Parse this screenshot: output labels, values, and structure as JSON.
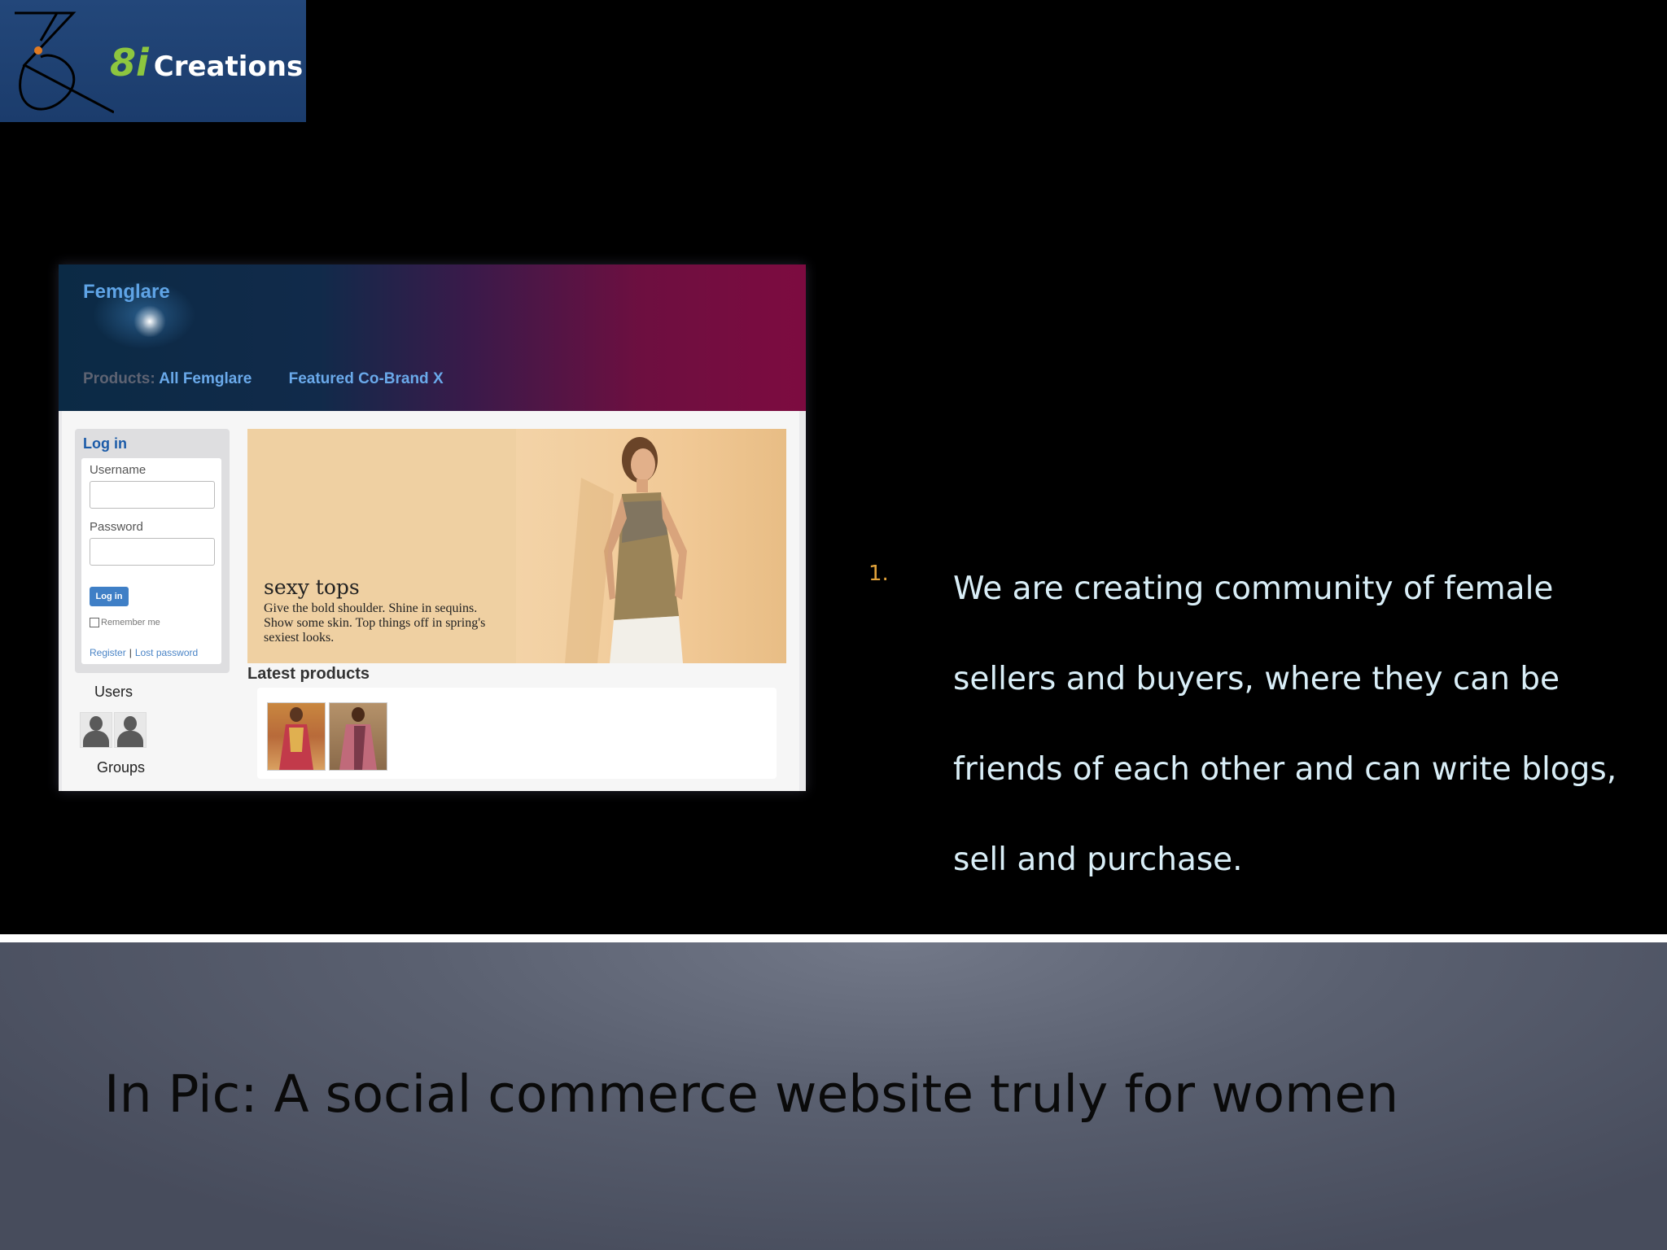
{
  "logo": {
    "number": "8i",
    "name": "Creations",
    "icon": "hourglass-swirl-icon"
  },
  "website": {
    "brand": "Femglare",
    "nav": {
      "prefix": "Products:",
      "link1": "All Femglare",
      "link2": "Featured Co-Brand X"
    },
    "login": {
      "title": "Log in",
      "username_label": "Username",
      "username_value": "",
      "password_label": "Password",
      "password_value": "",
      "button": "Log in",
      "remember": "Remember me",
      "register": "Register",
      "separator": "|",
      "lost_password": "Lost password"
    },
    "users_title": "Users",
    "groups_title": "Groups",
    "banner": {
      "headline": "sexy tops",
      "subtext": "Give the bold shoulder. Shine in sequins. Show some skin. Top things off in spring's sexiest looks."
    },
    "latest_products_title": "Latest products"
  },
  "bullet": {
    "number": "1.",
    "text": "We are creating community of female sellers and buyers, where they can be friends of each other and can write blogs, sell and purchase."
  },
  "caption": "In Pic: A social commerce website truly for women",
  "colors": {
    "logo_bg": "#1b3c6c",
    "logo_accent": "#8dc63f",
    "bullet_number": "#e2a33b",
    "bullet_text": "#d9eef7",
    "site_link": "#6aa9ea"
  }
}
